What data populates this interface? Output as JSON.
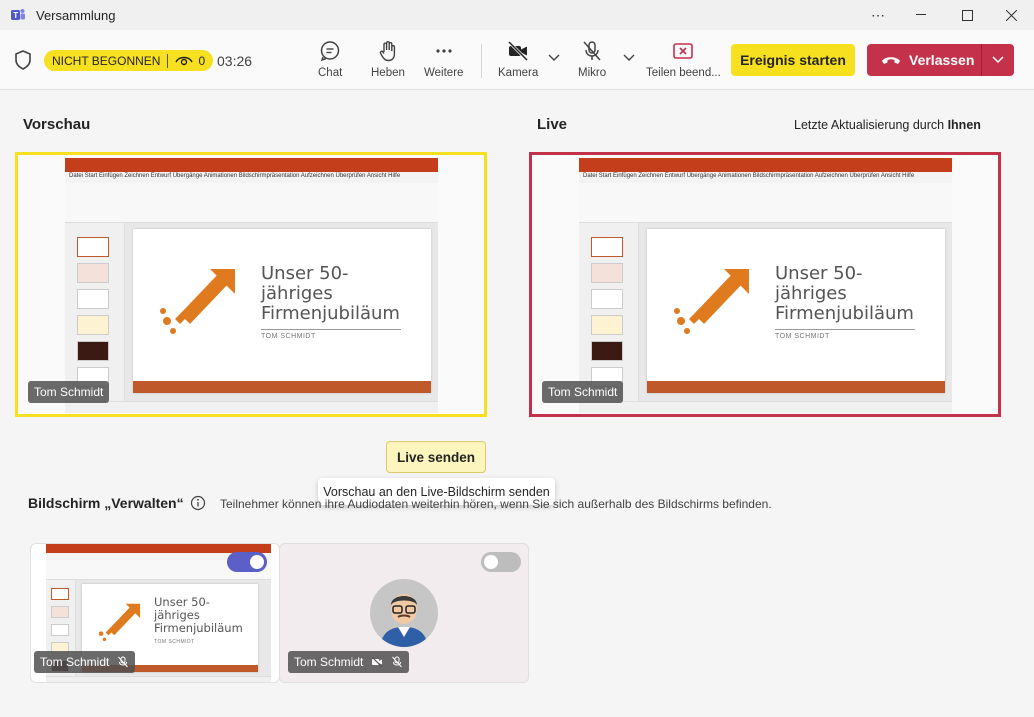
{
  "window": {
    "title": "Versammlung"
  },
  "status": {
    "label": "NICHT BEGONNEN",
    "viewers": "0",
    "timer": "03:26"
  },
  "toolbar": {
    "chat": "Chat",
    "raise": "Heben",
    "more": "Weitere",
    "camera": "Kamera",
    "mic": "Mikro",
    "stop_share": "Teilen beend...",
    "start_event": "Ereignis starten",
    "leave": "Verlassen"
  },
  "preview": {
    "label": "Vorschau",
    "presenter": "Tom Schmidt"
  },
  "live": {
    "label": "Live",
    "last_update_prefix": "Letzte Aktualisierung durch ",
    "last_update_by": "Ihnen",
    "presenter": "Tom Schmidt"
  },
  "slide": {
    "title_line1": "Unser 50-",
    "title_line2": "jähriges",
    "title_line3": "Firmenjubiläum",
    "subtitle": "TOM SCHMIDT"
  },
  "send_live": {
    "label": "Live senden",
    "tooltip": "Vorschau an den Live-Bildschirm senden"
  },
  "manage": {
    "title": "Bildschirm „Verwalten“",
    "description": "Teilnehmer können ihre Audiodaten weiterhin hören, wenn Sie sich außerhalb des Bildschirms befinden.",
    "cards": [
      {
        "name": "Tom Schmidt",
        "toggle_on": true
      },
      {
        "name": "Tom Schmidt",
        "toggle_on": false
      }
    ]
  },
  "colors": {
    "accent_yellow": "#f7e01f",
    "live_red": "#c4314b",
    "toggle_purple": "#5b5fc7"
  }
}
